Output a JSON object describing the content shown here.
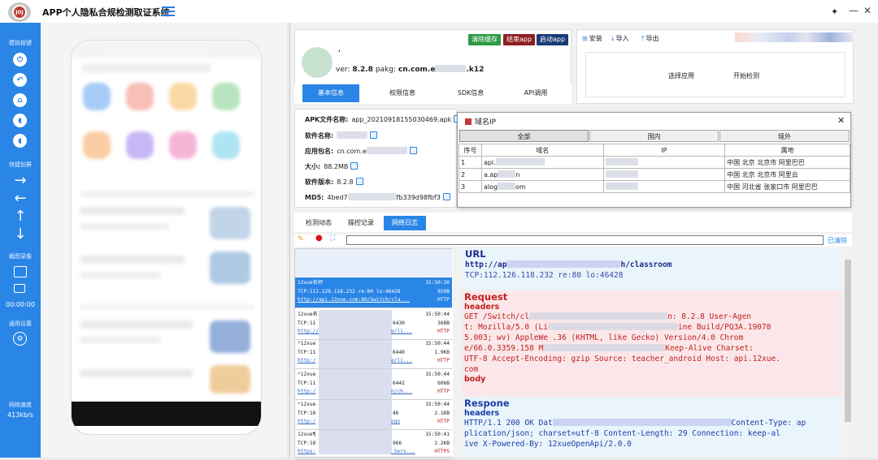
{
  "app": {
    "title": "APP个人隐私合规检测取证系统",
    "logo_text": "JOJ",
    "pin": "✦",
    "minimize": "—",
    "close": "✕"
  },
  "sidebar": {
    "sec_mock": "模拟按键",
    "sec_swipe": "快捷划屏",
    "sec_record": "截图录像",
    "sec_settings": "通用设置",
    "time": "00:00:00",
    "net_label": "网络速度",
    "net_value": "413kb/s",
    "arrows": [
      "→",
      "←",
      "↑",
      "↓"
    ],
    "mock_icons": [
      "power-icon",
      "back-icon",
      "home-icon",
      "volume-up-icon",
      "volume-down-icon"
    ]
  },
  "info": {
    "app_name": "'",
    "version_label": "ver:",
    "version": "8.2.8",
    "pkg_label": "pakg:",
    "pkg_prefix": "cn.com.e",
    "pkg_suffix": ".k12",
    "buttons": {
      "clear": "清除缓存",
      "end": "结束app",
      "start": "启动app"
    },
    "tabs": [
      "基本信息",
      "权限信息",
      "SDK信息",
      "API调用"
    ],
    "active_tab": 0
  },
  "tools": {
    "install": "安装",
    "import": "导入",
    "export": "导出",
    "choose": "选择应用",
    "start_detect": "开始检测"
  },
  "details": {
    "apk_label": "APK文件名称:",
    "apk_value": "app_20210918155030469.apk",
    "name_label": "软件名称:",
    "pkg_label": "应用包名:",
    "pkg_value": "cn.com.e",
    "size_label": "大小:",
    "size_value": "88.2MB",
    "ver_label": "软件版本:",
    "ver_value": "8.2.8",
    "md5_label": "MD5:",
    "md5_prefix": "4bed7",
    "md5_suffix": "fb339d98fbf3"
  },
  "domain_popup": {
    "title": "域名IP",
    "close": "✕",
    "tabs": [
      "全部",
      "国内",
      "境外"
    ],
    "headers": [
      "序号",
      "域名",
      "IP",
      "属地"
    ],
    "rows": [
      {
        "no": "1",
        "domain_a": "api.",
        "domain_b": "",
        "location": "中国 北京 北京市 阿里巴巴"
      },
      {
        "no": "2",
        "domain_a": "a.ap",
        "domain_b": "n",
        "location": "中国 北京 北京市 阿里云"
      },
      {
        "no": "3",
        "domain_a": "alog",
        "domain_b": "om",
        "location": "中国 河北省 张家口市 阿里巴巴"
      }
    ]
  },
  "log": {
    "tabs": [
      "检测动态",
      "操控记录",
      "网络日志"
    ],
    "active_tab": 2,
    "clear": "已清除",
    "requests": [
      {
        "star": "",
        "name": "12xue名师",
        "time": "15:50:39",
        "line2": "TCP:112.126.118.232 re:80 lo:46428",
        "size": "959B",
        "url": "http://api.12xue.com:80/Switch/cla...",
        "proto": "HTTP",
        "selected": true
      },
      {
        "star": "",
        "name": "12xue名",
        "time": "15:50:44",
        "line2": "TCP:11",
        "mid": "6430",
        "size": "368B",
        "url": "http://",
        "url2": "e/li...",
        "proto": "HTTP",
        "selected": false
      },
      {
        "star": "*",
        "name": "12xue",
        "time": "15:50:44",
        "line2": "TCP:11",
        "mid": "6440",
        "size": "1.9KB",
        "url": "http:/",
        "url2": "e/li...",
        "proto": "HTTP",
        "selected": false
      },
      {
        "star": "*",
        "name": "12xue",
        "time": "15:50:44",
        "line2": "TCP:11",
        "mid": "6442",
        "size": "606B",
        "url": "http:/",
        "url2": "n/ch...",
        "proto": "HTTP",
        "selected": false
      },
      {
        "star": "*",
        "name": "12xue",
        "time": "15:50:44",
        "line2": "TCP:10",
        "mid": "46",
        "size": "2.1KB",
        "url": "http:/",
        "url2": "ogs",
        "proto": "HTTP",
        "selected": false
      },
      {
        "star": "",
        "name": "12xue¶",
        "time": "15:50:41",
        "line2": "TCP:18",
        "mid": "966",
        "size": "2.2KB",
        "url": "https:",
        "url2": "_Serv...",
        "proto": "HTTPS",
        "selected": false
      }
    ],
    "detail": {
      "url_title": "URL",
      "url_a": "http://ap",
      "url_b": "h/classroom",
      "tcp": "TCP:112.126.118.232 re:80 lo:46428",
      "req_title": "Request",
      "headers": "headers",
      "req_l1a": "GET /Switch/cl",
      "req_l1b": "n: 8.2.8 User-Agen",
      "req_l2a": "t: Mozilla/5.0 (Li",
      "req_l2b": "ine Build/PQ3A.19070",
      "req_l3": "5.003; wv) AppleWe          .36 (KHTML, like Gecko) Version/4.0 Chrom",
      "req_l4a": "e/66.0.3359.158 M",
      "req_l4b": "Keep-Alive Charset:",
      "req_l5": "UTF-8 Accept-Encoding: gzip Source: teacher_android Host: api.12xue.",
      "req_l6": "com",
      "body": "body",
      "resp_title": "Respone",
      "resp_l1a": "HTTP/1.1 200 OK Dat",
      "resp_l1b": "Content-Type: ap",
      "resp_l2": "plication/json; charset=utf-8 Content-Length: 29 Connection: keep-al",
      "resp_l3": "ive X-Powered-By: 12xueOpenApi/2.0.0"
    }
  },
  "colors": {
    "accent": "#2a86e6",
    "clear": "#2e9a44",
    "end": "#8e1f1f",
    "start": "#1b3a78"
  }
}
